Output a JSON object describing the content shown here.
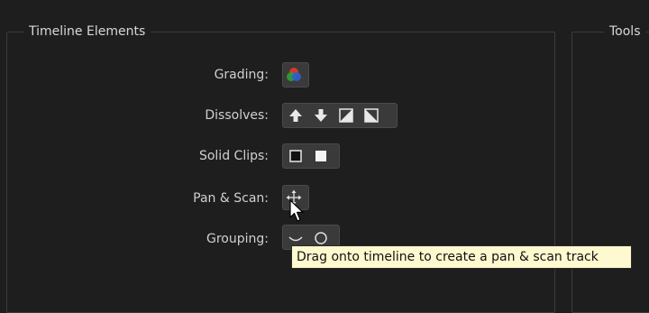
{
  "panels": {
    "timeline_title": "Timeline Elements",
    "tools_title": "Tools"
  },
  "rows": {
    "grading": "Grading:",
    "dissolves": "Dissolves:",
    "solid_clips": "Solid Clips:",
    "pan_scan": "Pan & Scan:",
    "grouping": "Grouping:"
  },
  "icons": {
    "grading": "color-wheels-icon",
    "dissolves": [
      "arrow-up-icon",
      "arrow-down-icon",
      "diagonal-wipe-up-icon",
      "diagonal-wipe-down-icon"
    ],
    "solid_clips": [
      "black-solid-icon",
      "white-solid-icon"
    ],
    "pan_scan": "move-arrows-icon",
    "grouping": [
      "group-open-icon",
      "group-closed-icon"
    ]
  },
  "tooltip": {
    "text": "Drag onto timeline to create a pan & scan track"
  },
  "colors": {
    "background": "#1e1e1e",
    "button_bg": "#3a3a3a",
    "tooltip_bg": "#fff9cf"
  }
}
